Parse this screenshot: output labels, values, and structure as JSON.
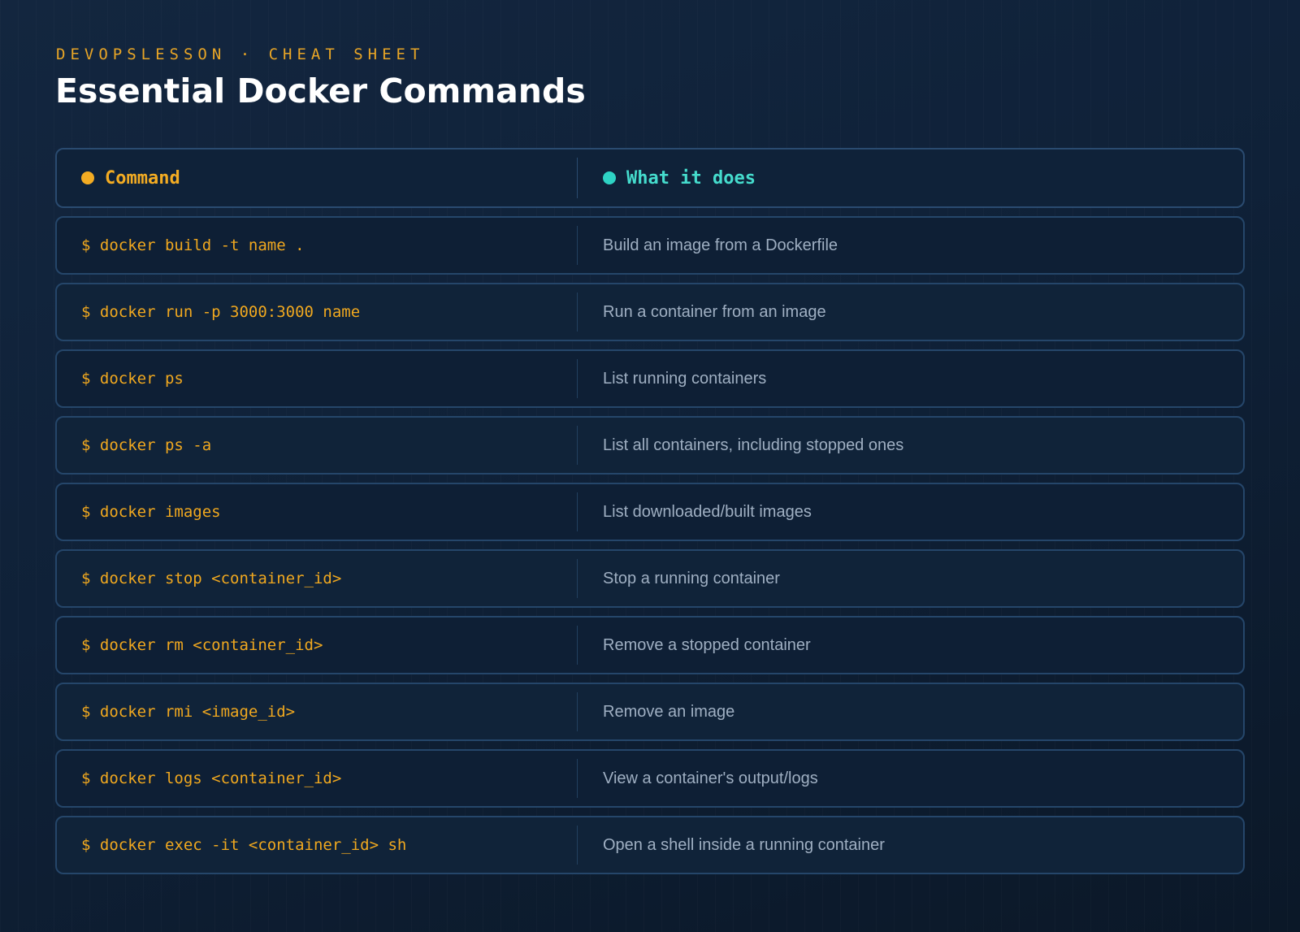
{
  "header": {
    "kicker": "DEVOPSLESSON · CHEAT SHEET",
    "title": "Essential Docker Commands"
  },
  "table": {
    "columns": {
      "command": "Command",
      "description": "What it does"
    },
    "rows": [
      {
        "command": "$ docker build -t name .",
        "description": "Build an image from a Dockerfile"
      },
      {
        "command": "$ docker run -p 3000:3000 name",
        "description": "Run a container from an image"
      },
      {
        "command": "$ docker ps",
        "description": "List running containers"
      },
      {
        "command": "$ docker ps -a",
        "description": "List all containers, including stopped ones"
      },
      {
        "command": "$ docker images",
        "description": "List downloaded/built images"
      },
      {
        "command": "$ docker stop <container_id>",
        "description": "Stop a running container"
      },
      {
        "command": "$ docker rm <container_id>",
        "description": "Remove a stopped container"
      },
      {
        "command": "$ docker rmi <image_id>",
        "description": "Remove an image"
      },
      {
        "command": "$ docker logs <container_id>",
        "description": "View a container's output/logs"
      },
      {
        "command": "$ docker exec -it <container_id> sh",
        "description": "Open a shell inside a running container"
      }
    ]
  },
  "colors": {
    "accent_amber": "#f3ac23",
    "accent_teal": "#2ed3c4",
    "background": "#0f2138"
  }
}
